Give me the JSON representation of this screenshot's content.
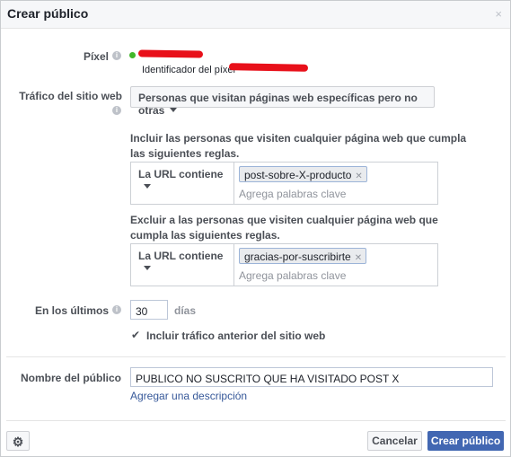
{
  "dialog": {
    "title": "Crear público",
    "close_glyph": "×"
  },
  "pixel": {
    "label": "Píxel",
    "status_color": "#42b72a",
    "id_label": "Identificador del píxel"
  },
  "traffic": {
    "label": "Tráfico del sitio web",
    "selected": "Personas que visitan páginas web específicas pero no otras"
  },
  "include_rule": {
    "text": "Incluir las personas que visiten cualquier página web que cumpla las siguientes reglas.",
    "condition": "La URL contiene",
    "token": "post-sobre-X-producto",
    "placeholder": "Agrega palabras clave"
  },
  "exclude_rule": {
    "text": "Excluir a las personas que visiten cualquier página web que cumpla las siguientes reglas.",
    "condition": "La URL contiene",
    "token": "gracias-por-suscribirte",
    "placeholder": "Agrega palabras clave"
  },
  "retention": {
    "label": "En los últimos",
    "value": "30",
    "unit": "días",
    "checkbox_label": "Incluir tráfico anterior del sitio web",
    "checkbox_checked": true
  },
  "audience_name": {
    "label": "Nombre del público",
    "value": "PUBLICO NO SUSCRITO QUE HA VISITADO POST X",
    "add_description": "Agregar una descripción"
  },
  "footer": {
    "settings_icon": "gear-icon",
    "cancel_label": "Cancelar",
    "create_label": "Crear público",
    "primary_color": "#4267b2"
  }
}
